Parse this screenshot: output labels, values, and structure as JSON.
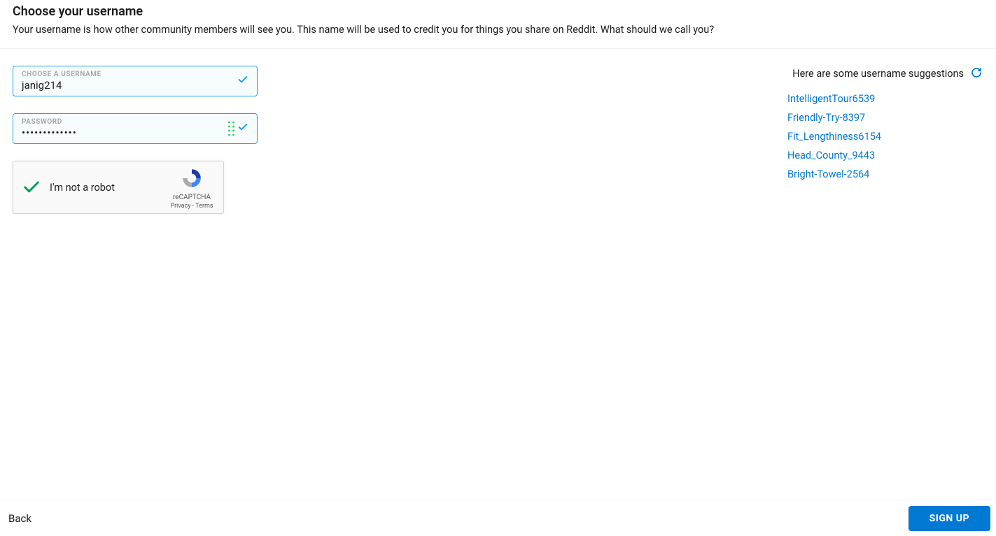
{
  "header": {
    "title": "Choose your username",
    "subtitle": "Your username is how other community members will see you. This name will be used to credit you for things you share on Reddit. What should we call you?"
  },
  "form": {
    "username": {
      "label": "CHOOSE A USERNAME",
      "value": "janig214"
    },
    "password": {
      "label": "PASSWORD",
      "value": "•••••••••••••"
    }
  },
  "recaptcha": {
    "label": "I'm not a robot",
    "brand": "reCAPTCHA",
    "privacy": "Privacy",
    "terms": "Terms"
  },
  "suggestions": {
    "header": "Here are some username suggestions",
    "items": [
      "IntelligentTour6539",
      "Friendly-Try-8397",
      "Fit_Lengthiness6154",
      "Head_County_9443",
      "Bright-Towel-2564"
    ]
  },
  "footer": {
    "back": "Back",
    "signup": "SIGN UP"
  }
}
